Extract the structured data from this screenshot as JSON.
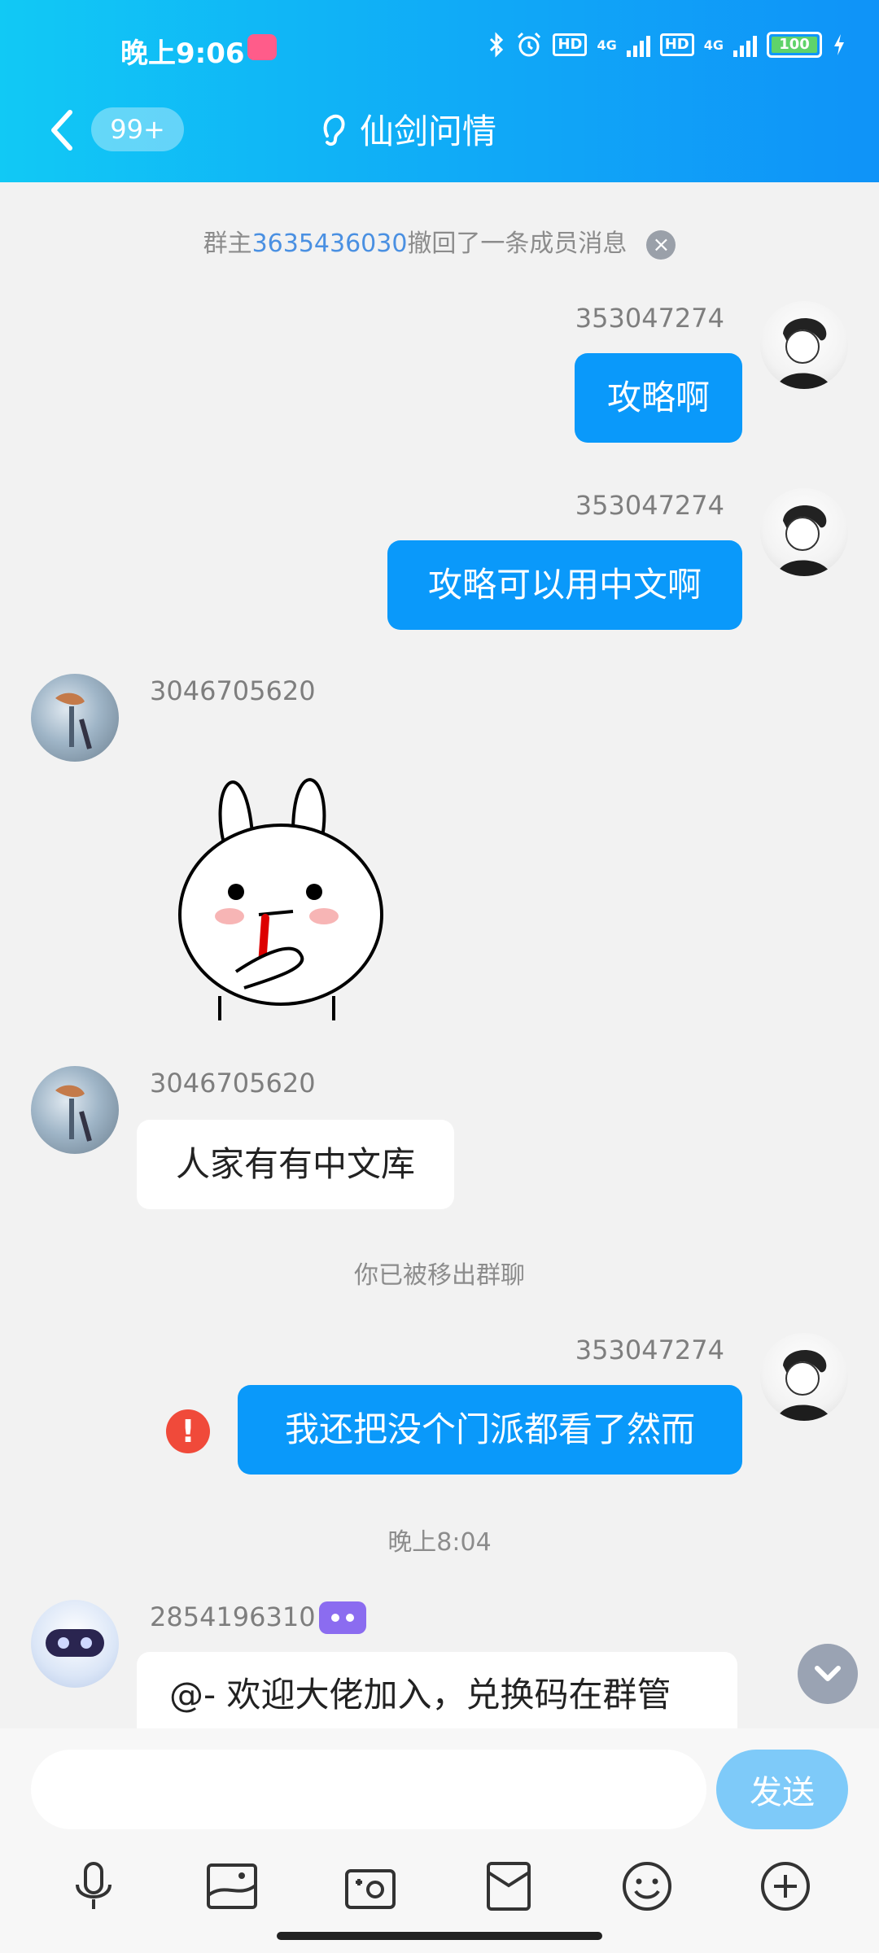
{
  "status_bar": {
    "time": "晚上9:06",
    "network": "4G",
    "battery": "100"
  },
  "header": {
    "unread_badge": "99+",
    "title": "仙剑问情"
  },
  "messages": {
    "recall_notice": {
      "prefix": "群主",
      "user_id": "3635436030",
      "suffix": "撤回了一条成员消息"
    },
    "m1": {
      "sender": "353047274",
      "text": "攻略啊"
    },
    "m2": {
      "sender": "353047274",
      "text": "攻略可以用中文啊"
    },
    "m3": {
      "sender": "3046705620"
    },
    "m4": {
      "sender": "3046705620",
      "text": "人家有有中文库"
    },
    "removed_notice": "你已被移出群聊",
    "m5": {
      "sender": "353047274",
      "text": "我还把没个门派都看了然而"
    },
    "time_divider": "晚上8:04",
    "m6": {
      "sender": "2854196310",
      "text": "@- 欢迎大佬加入，兑换码在群管"
    }
  },
  "input": {
    "placeholder": "",
    "send_label": "发送"
  },
  "toolbar": {
    "icons": [
      "microphone-icon",
      "picture-icon",
      "camera-icon",
      "red-packet-icon",
      "emoji-icon",
      "plus-icon"
    ]
  },
  "colors": {
    "header_start": "#11c9f5",
    "header_end": "#0f93f8",
    "my_bubble": "#0a99fa",
    "link": "#4a90e2",
    "error": "#f04a3a"
  }
}
